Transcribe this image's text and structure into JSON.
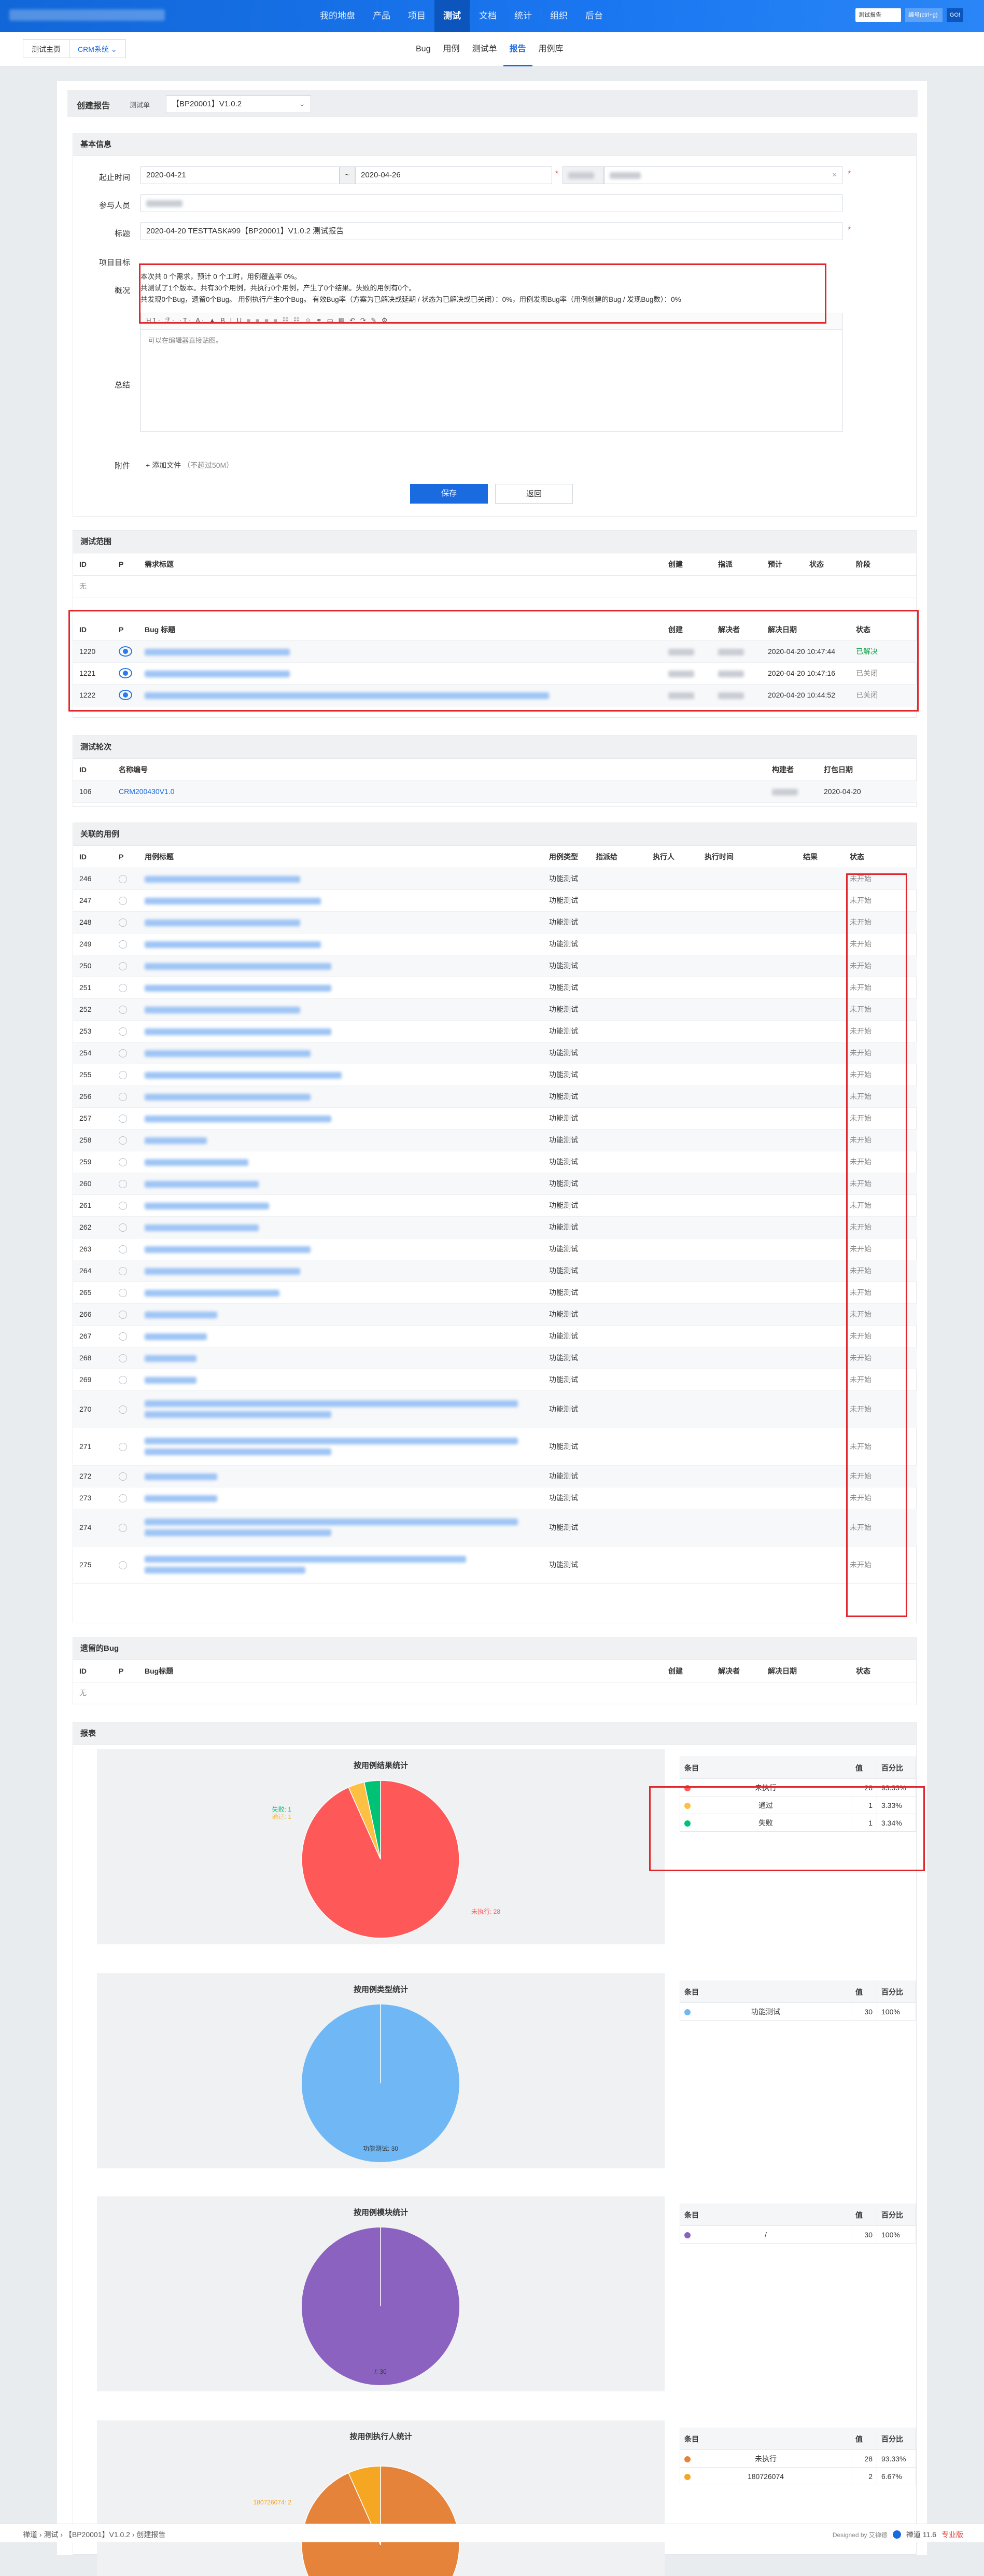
{
  "nav": {
    "items": [
      "我的地盘",
      "产品",
      "项目",
      "测试",
      "文档",
      "统计",
      "组织",
      "后台"
    ],
    "active": "测试",
    "search_type": "测试报告",
    "search_placeholder": "编号(ctrl+g)",
    "go": "GO!"
  },
  "breadcrumb": {
    "home": "测试主页",
    "product": "CRM系统"
  },
  "subnav": {
    "items": [
      "Bug",
      "用例",
      "测试单",
      "报告",
      "用例库"
    ],
    "active": "报告"
  },
  "create": {
    "title": "创建报告",
    "label": "测试单",
    "value": "【BP20001】V1.0.2"
  },
  "basic": {
    "title": "基本信息",
    "begin_label": "起止时间",
    "begin": "2020-04-21",
    "end": "2020-04-26",
    "owner_label": "负责人",
    "members_label": "参与人员",
    "title_label": "标题",
    "title_value": "2020-04-20 TESTTASK#99【BP20001】V1.0.2 测试报告",
    "goal_label": "项目目标",
    "overview_label": "概况",
    "overview_1": "本次共 0 个需求，预计 0 个工时，用例覆盖率 0%。",
    "overview_2": "共测试了1个版本。共有30个用例，共执行0个用例，产生了0个结果。失败的用例有0个。",
    "overview_3": "共发现0个Bug，遗留0个Bug。 用例执行产生0个Bug。 有效Bug率（方案为已解决或延期 / 状态为已解决或已关闭）：0%，用例发现Bug率（用例创建的Bug / 发现Bug数）：0%",
    "summary_label": "总结",
    "editor_placeholder": "可以在编辑器直接贴图。",
    "files_label": "附件",
    "add_file": "+ 添加文件",
    "file_hint": "（不超过50M）",
    "save": "保存",
    "back": "返回"
  },
  "scope": {
    "title": "测试范围",
    "headers": [
      "ID",
      "P",
      "需求标题",
      "创建",
      "指派",
      "预计",
      "状态",
      "阶段"
    ],
    "empty": "无"
  },
  "bugs": {
    "headers": [
      "ID",
      "P",
      "Bug 标题",
      "创建",
      "解决者",
      "解决日期",
      "状态"
    ],
    "rows": [
      {
        "id": "1220",
        "date": "2020-04-20 10:47:44",
        "status": "已解决"
      },
      {
        "id": "1221",
        "date": "2020-04-20 10:47:16",
        "status": "已关闭"
      },
      {
        "id": "1222",
        "date": "2020-04-20 10:44:52",
        "status": "已关闭"
      }
    ]
  },
  "builds": {
    "title": "测试轮次",
    "headers": [
      "ID",
      "名称编号",
      "",
      "构建者",
      "打包日期"
    ],
    "rows": [
      {
        "id": "106",
        "name": "CRM200430V1.0",
        "date": "2020-04-20"
      }
    ]
  },
  "cases": {
    "title": "关联的用例",
    "headers": [
      "ID",
      "P",
      "用例标题",
      "用例类型",
      "指派给",
      "执行人",
      "执行时间",
      "结果",
      "状态"
    ],
    "type": "功能测试",
    "status": "未开始",
    "ids": [
      "246",
      "247",
      "248",
      "249",
      "250",
      "251",
      "252",
      "253",
      "254",
      "255",
      "256",
      "257",
      "258",
      "259",
      "260",
      "261",
      "262",
      "263",
      "264",
      "265",
      "266",
      "267",
      "268",
      "269",
      "270",
      "271",
      "272",
      "273",
      "274",
      "275"
    ]
  },
  "legacy": {
    "title": "遗留的Bug",
    "headers": [
      "ID",
      "P",
      "Bug标题",
      "创建",
      "解决者",
      "解决日期",
      "状态"
    ],
    "empty": "无"
  },
  "report": {
    "title": "报表",
    "table_headers": [
      "条目",
      "值",
      "百分比"
    ]
  },
  "chart_data": [
    {
      "type": "pie",
      "title": "按用例结果统计",
      "categories": [
        "未执行",
        "通过",
        "失败"
      ],
      "values": [
        28,
        1,
        1
      ],
      "percent": [
        "93.33%",
        "3.33%",
        "3.34%"
      ],
      "colors": [
        "#ff5858",
        "#fdc043",
        "#00c274"
      ],
      "slice_labels": [
        "未执行: 28",
        "通过: 1",
        "失败: 1"
      ]
    },
    {
      "type": "pie",
      "title": "按用例类型统计",
      "categories": [
        "功能测试"
      ],
      "values": [
        30
      ],
      "percent": [
        "100%"
      ],
      "colors": [
        "#6fb8f5"
      ],
      "slice_labels": [
        "功能测试: 30"
      ]
    },
    {
      "type": "pie",
      "title": "按用例模块统计",
      "categories": [
        "/"
      ],
      "values": [
        30
      ],
      "percent": [
        "100%"
      ],
      "colors": [
        "#8c62c0"
      ],
      "slice_labels": [
        "/: 30"
      ]
    },
    {
      "type": "pie",
      "title": "按用例执行人统计",
      "categories": [
        "未执行",
        "180726074"
      ],
      "values": [
        28,
        2
      ],
      "percent": [
        "93.33%",
        "6.67%"
      ],
      "colors": [
        "#e6833a",
        "#f5a623"
      ],
      "slice_labels": [
        "180726074: 2"
      ]
    }
  ],
  "footer": {
    "path": "禅道 › 测试 › 【BP20001】V1.0.2 › 创建报告",
    "designed": "Designed by 艾禅德",
    "version": "禅道 11.6",
    "pro": "专业版"
  }
}
